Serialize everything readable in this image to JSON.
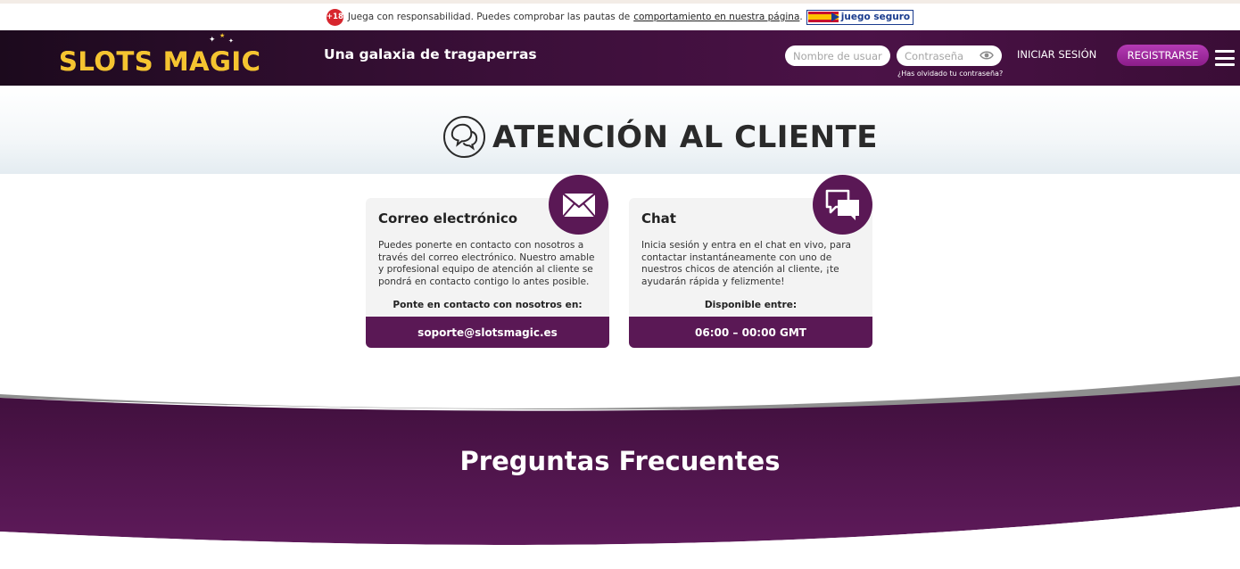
{
  "notice": {
    "age_badge": "+18",
    "text": "Juega con responsabilidad. Puedes comprobar las pautas de",
    "link": "comportamiento en nuestra página",
    "link_suffix": ".",
    "badge_text": "juego seguro"
  },
  "header": {
    "logo_text": "SLOTS MAGIC",
    "tagline": "Una galaxia de tragaperras",
    "username_placeholder": "Nombre de usuario",
    "password_placeholder": "Contraseña",
    "forgot_password": "¿Has olvidado tu contraseña?",
    "login_label": "INICIAR SESIÓN",
    "register_label": "REGISTRARSE"
  },
  "hero": {
    "title": "ATENCIÓN AL CLIENTE"
  },
  "cards": [
    {
      "title": "Correo electrónico",
      "body": "Puedes ponerte en contacto con nosotros a través del correo electrónico. Nuestro amable y profesional equipo de atención al cliente se pondrá en contacto contigo lo antes posible.",
      "subheading": "Ponte en contacto con nosotros en:",
      "value": "soporte@slotsmagic.es"
    },
    {
      "title": "Chat",
      "body": "Inicia sesión y entra en el chat en vivo, para contactar instantáneamente con uno de nuestros chicos de atención al cliente, ¡te ayudarán rápida y felizmente!",
      "subheading": "Disponible entre:",
      "value": "06:00 – 00:00 GMT"
    }
  ],
  "faq": {
    "title": "Preguntas Frecuentes"
  },
  "colors": {
    "brand_purple": "#5a1855",
    "register_gradient_top": "#b43bb4",
    "logo_gold": "#f5c430",
    "age_red": "#d7262e"
  },
  "icons": [
    "chat-bubbles-outline-icon",
    "envelope-icon",
    "chat-icon",
    "eye-icon",
    "hamburger-menu-icon",
    "spanish-flag-icon"
  ]
}
